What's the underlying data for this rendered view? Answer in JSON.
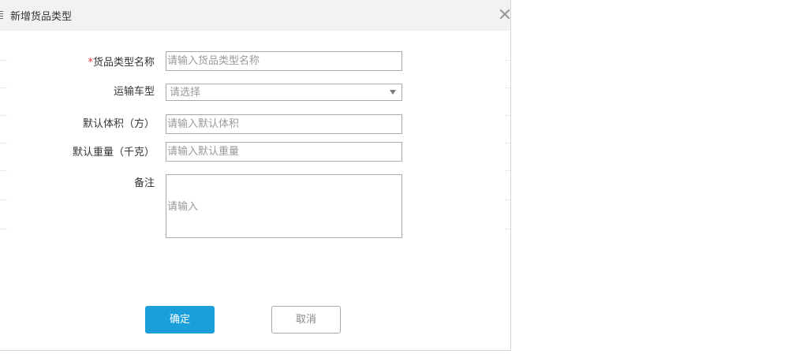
{
  "dialog": {
    "title": "新增货品类型",
    "title_icon": "list-icon",
    "close_icon": "close-icon"
  },
  "form": {
    "required_mark": "*",
    "fields": [
      {
        "label": "货品类型名称",
        "required": true,
        "value": "",
        "placeholder": "请输入货品类型名称"
      },
      {
        "label": "运输车型",
        "selected": "请选择",
        "arrow_icon": "caret-down-icon"
      },
      {
        "label": "默认体积（方）",
        "value": "",
        "placeholder": "请输入默认体积"
      },
      {
        "label": "默认重量（千克）",
        "value": "",
        "placeholder": "请输入默认重量"
      },
      {
        "label": "备注",
        "value": "",
        "placeholder": "请输入"
      }
    ]
  },
  "buttons": {
    "confirm_label": "确定",
    "cancel_label": "取消"
  },
  "colors": {
    "header_bg": "#f2f2f2",
    "primary": "#1a9fdb",
    "required": "#e4393c",
    "placeholder": "#999999",
    "field_border": "#a9a9a9",
    "text": "#333333"
  }
}
